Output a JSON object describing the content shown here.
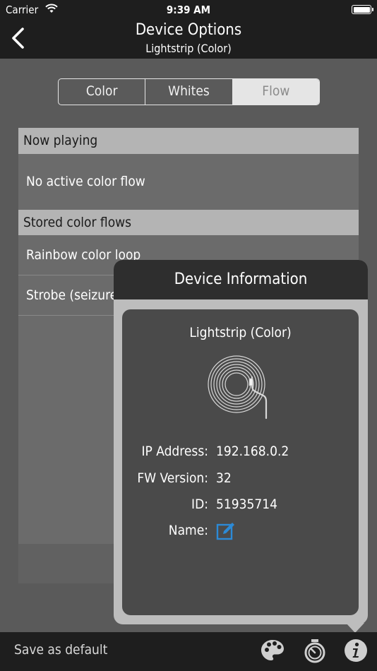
{
  "status_bar": {
    "carrier": "Carrier",
    "time": "9:39 AM"
  },
  "nav": {
    "title": "Device Options",
    "subtitle": "Lightstrip (Color)",
    "back_icon": "chevron-left-icon"
  },
  "segments": [
    {
      "label": "Color",
      "selected": false
    },
    {
      "label": "Whites",
      "selected": false
    },
    {
      "label": "Flow",
      "selected": true
    }
  ],
  "now_playing": {
    "header": "Now playing",
    "value": "No active color flow"
  },
  "stored_flows": {
    "header": "Stored color flows",
    "items": [
      {
        "label": "Rainbow color loop"
      },
      {
        "label": "Strobe (seizure"
      }
    ]
  },
  "device_info": {
    "title": "Device Information",
    "device_name": "Lightstrip (Color)",
    "image_icon": "lightstrip-icon",
    "rows": [
      {
        "label": "IP Address:",
        "value": "192.168.0.2"
      },
      {
        "label": "FW Version:",
        "value": "32"
      },
      {
        "label": "ID:",
        "value": "51935714"
      }
    ],
    "name_label": "Name:",
    "edit_icon": "edit-icon"
  },
  "toolbar": {
    "save_default": "Save as default",
    "icons": [
      "palette-icon",
      "timer-icon",
      "info-icon"
    ]
  },
  "colors": {
    "accent": "#2c8ad6",
    "background": "#5a5a5a",
    "bar": "#1e1e1e"
  }
}
